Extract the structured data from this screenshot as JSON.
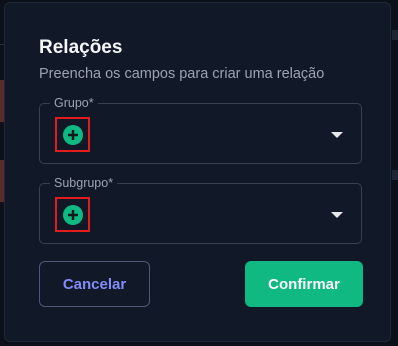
{
  "dialog": {
    "title": "Relações",
    "subtitle": "Preencha os campos para criar uma relação"
  },
  "fields": [
    {
      "label": "Grupo*",
      "value": ""
    },
    {
      "label": "Subgrupo*",
      "value": ""
    }
  ],
  "actions": {
    "cancel_label": "Cancelar",
    "confirm_label": "Confirmar"
  },
  "colors": {
    "dialog_background": "#111827",
    "confirm_accent": "#10b981",
    "cancel_text": "#818cf8",
    "add_icon": "#10b981",
    "highlight_box": "#e11d1d"
  },
  "icons": {
    "add": "plus-circle-icon",
    "dropdown": "caret-down-icon"
  }
}
